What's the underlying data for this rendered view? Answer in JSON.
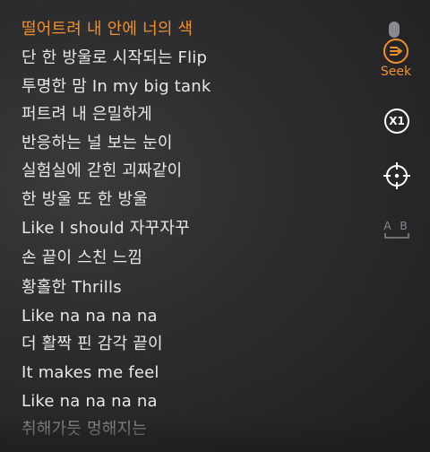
{
  "lyrics": [
    {
      "text": "떨어트려 내 안에 너의 색",
      "state": "active"
    },
    {
      "text": "단 한 방울로 시작되는 Flip",
      "state": "normal"
    },
    {
      "text": "투명한 맘 In my big tank",
      "state": "normal"
    },
    {
      "text": "퍼트려 내 은밀하게",
      "state": "normal"
    },
    {
      "text": "반응하는 널 보는 눈이",
      "state": "normal"
    },
    {
      "text": "실험실에 갇힌 괴짜같이",
      "state": "normal"
    },
    {
      "text": "한 방울 또 한 방울",
      "state": "normal"
    },
    {
      "text": "Like I should 자꾸자꾸",
      "state": "normal"
    },
    {
      "text": "손 끝이 스친 느낌",
      "state": "normal"
    },
    {
      "text": "황홀한 Thrills",
      "state": "normal"
    },
    {
      "text": "Like na na na na",
      "state": "normal"
    },
    {
      "text": "더 활짝 핀 감각 끝이",
      "state": "normal"
    },
    {
      "text": "It makes me feel",
      "state": "normal"
    },
    {
      "text": "Like na na na na",
      "state": "normal"
    },
    {
      "text": "취해가듯 멍해지는",
      "state": "faded"
    }
  ],
  "controls": {
    "seek_label": "Seek",
    "speed_label": "X1",
    "ab_label": "A B"
  },
  "colors": {
    "accent": "#f0902a",
    "text": "#e8e8ea",
    "icon": "#ffffff",
    "muted": "#8a8a8e"
  },
  "icons": {
    "seek": "seek-icon",
    "speed": "speed-icon",
    "target": "crosshair-icon",
    "ab_repeat": "ab-repeat-icon",
    "slider_handle": "slider-handle-icon"
  }
}
